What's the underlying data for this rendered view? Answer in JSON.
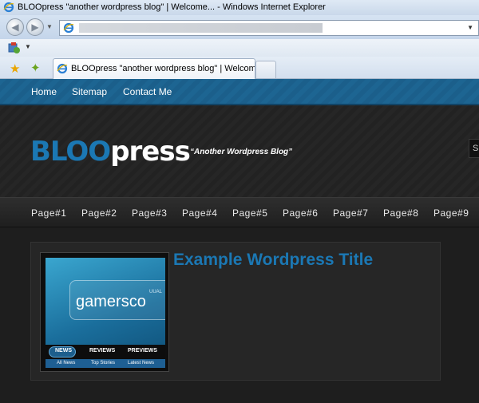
{
  "browser": {
    "window_title": "BLOOpress \"another wordpress blog\" | Welcome... - Windows Internet Explorer",
    "tab_title": "BLOOpress \"another wordpress blog\" | Welcome..."
  },
  "site": {
    "top_nav": [
      "Home",
      "Sitemap",
      "Contact Me"
    ],
    "logo_part1": "BLOO",
    "logo_part2": "press",
    "tagline": "“Another Wordpress Blog”",
    "search_value": "S",
    "page_nav": [
      "Page#1",
      "Page#2",
      "Page#3",
      "Page#4",
      "Page#5",
      "Page#6",
      "Page#7",
      "Page#8",
      "Page#9"
    ],
    "accent_color": "#1b78b4"
  },
  "post": {
    "title": "Example Wordpress Title",
    "thumbnail": {
      "brand": "gamersco",
      "tag": "UUAL",
      "menu": [
        "NEWS",
        "REVIEWS",
        "PREVIEWS"
      ],
      "submenu": [
        "All News",
        "Top Stories",
        "Latest News"
      ]
    }
  }
}
